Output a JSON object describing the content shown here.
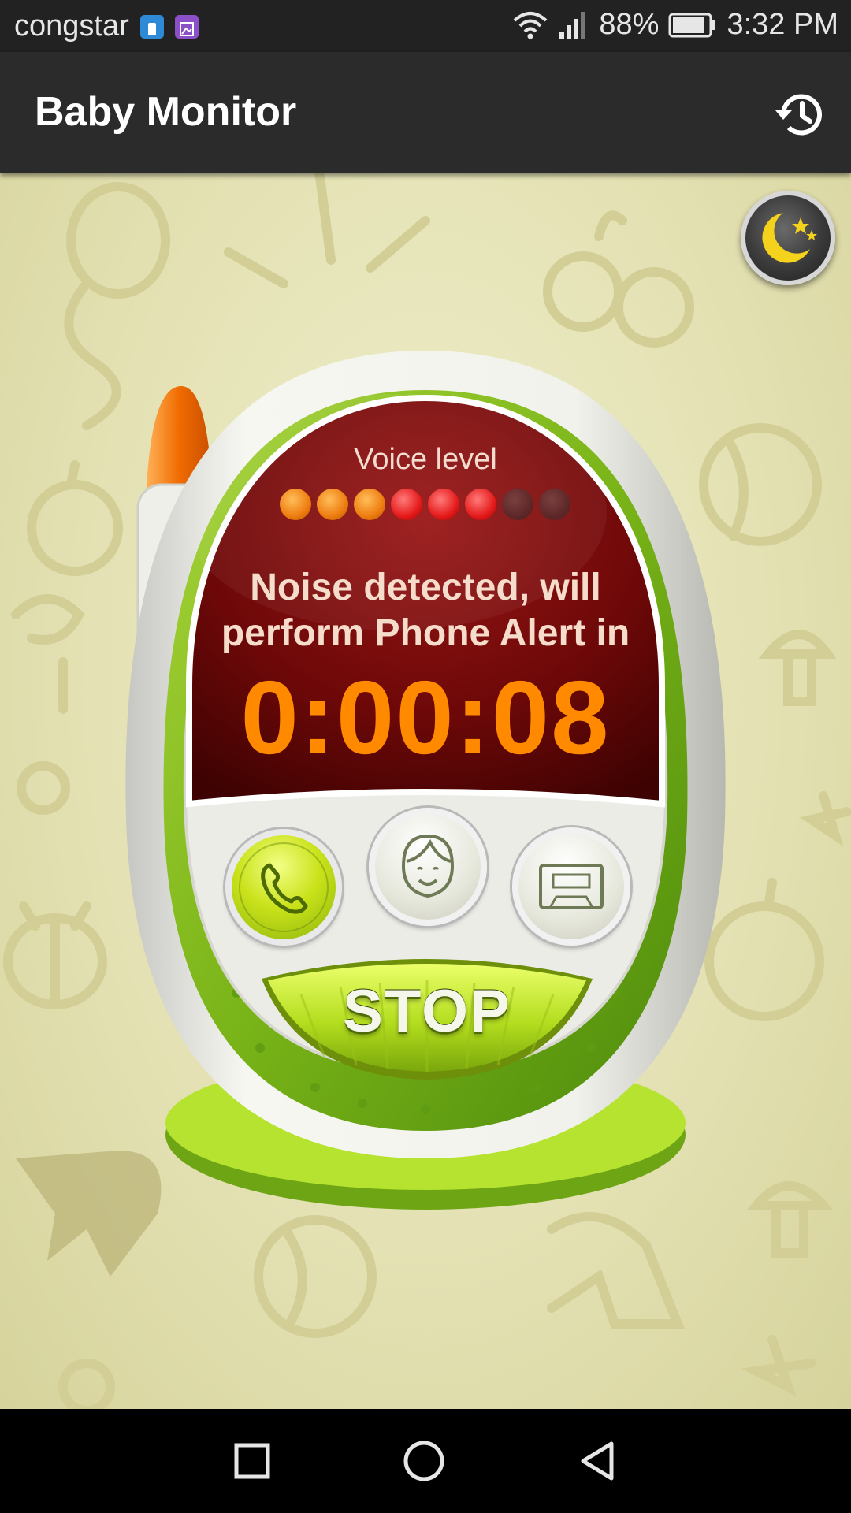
{
  "status_bar": {
    "carrier": "congstar",
    "battery_percent": "88%",
    "time": "3:32 PM",
    "icons": [
      "sim-icon",
      "gallery-icon",
      "wifi-icon",
      "signal-icon",
      "battery-icon"
    ]
  },
  "app_bar": {
    "title": "Baby Monitor",
    "history_icon": "history-icon"
  },
  "monitor": {
    "voice_level_label": "Voice level",
    "voice_level": {
      "lit": 6,
      "total": 8,
      "colors": [
        "orange",
        "orange",
        "orange",
        "red",
        "red",
        "red",
        "off",
        "off"
      ]
    },
    "alert_message": "Noise detected, will perform Phone Alert in",
    "countdown": "0:00:08",
    "mode_buttons": [
      {
        "name": "phone-alert",
        "icon": "phone-icon",
        "active": true
      },
      {
        "name": "parent-voice",
        "icon": "face-icon",
        "active": false
      },
      {
        "name": "recorder",
        "icon": "cassette-icon",
        "active": false
      }
    ],
    "stop_label": "STOP",
    "night_mode_icon": "moon-stars-icon"
  },
  "nav_bar": {
    "buttons": [
      "recents-icon",
      "home-icon",
      "back-icon"
    ]
  },
  "colors": {
    "background": "#e4e2b4",
    "screen": "#7a0b0b",
    "timer": "#ff8a00",
    "green": "#9ccd1c",
    "doodle": "#d4d19b"
  }
}
